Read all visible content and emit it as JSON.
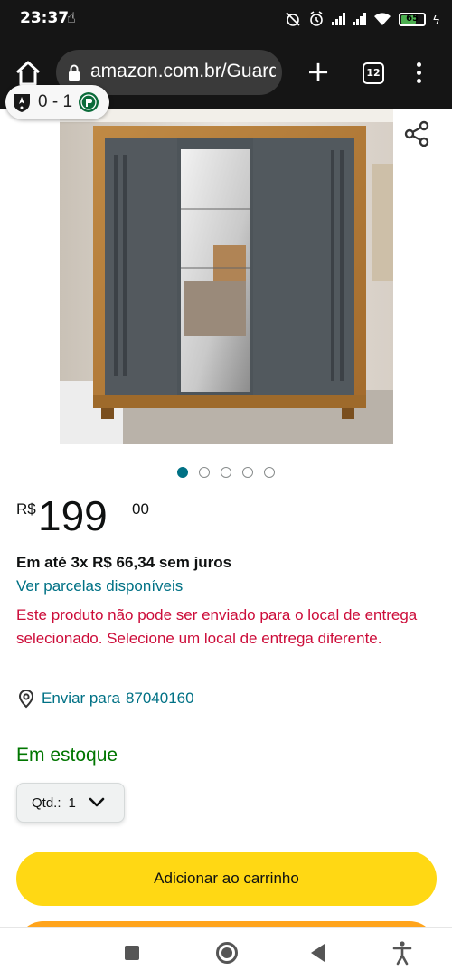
{
  "status_bar": {
    "time": "23:37",
    "battery": "65",
    "battery_level": 0.65
  },
  "browser": {
    "url": "amazon.com.br/Guarda-Roupa-Casal",
    "tab_count": "12"
  },
  "score_widget": {
    "score": "0 - 1",
    "home_team_icon": "atletico-mg-crest-icon",
    "away_team_icon": "palmeiras-crest-icon"
  },
  "product": {
    "image_alt": "wardrobe-photo",
    "carousel": {
      "count": 5,
      "active_index": 0
    }
  },
  "price": {
    "currency": "R$",
    "whole": "199",
    "fraction": "00"
  },
  "installment": "Em até 3x R$ 66,34 sem juros",
  "installment_link": "Ver parcelas disponíveis",
  "delivery_warning": "Este produto não pode ser enviado para o local de entrega selecionado. Selecione um local de entrega diferente.",
  "deliver_to": {
    "label": "Enviar para",
    "zip": "87040160"
  },
  "stock_status": "Em estoque",
  "quantity": {
    "label": "Qtd.:",
    "value": "1"
  },
  "buttons": {
    "add_to_cart": "Adicionar ao carrinho"
  },
  "colors": {
    "link": "#007185",
    "warning": "#cc0c39",
    "in_stock": "#007600",
    "add_to_cart_bg": "#ffd814",
    "buy_now_bg": "#ffa41c"
  }
}
